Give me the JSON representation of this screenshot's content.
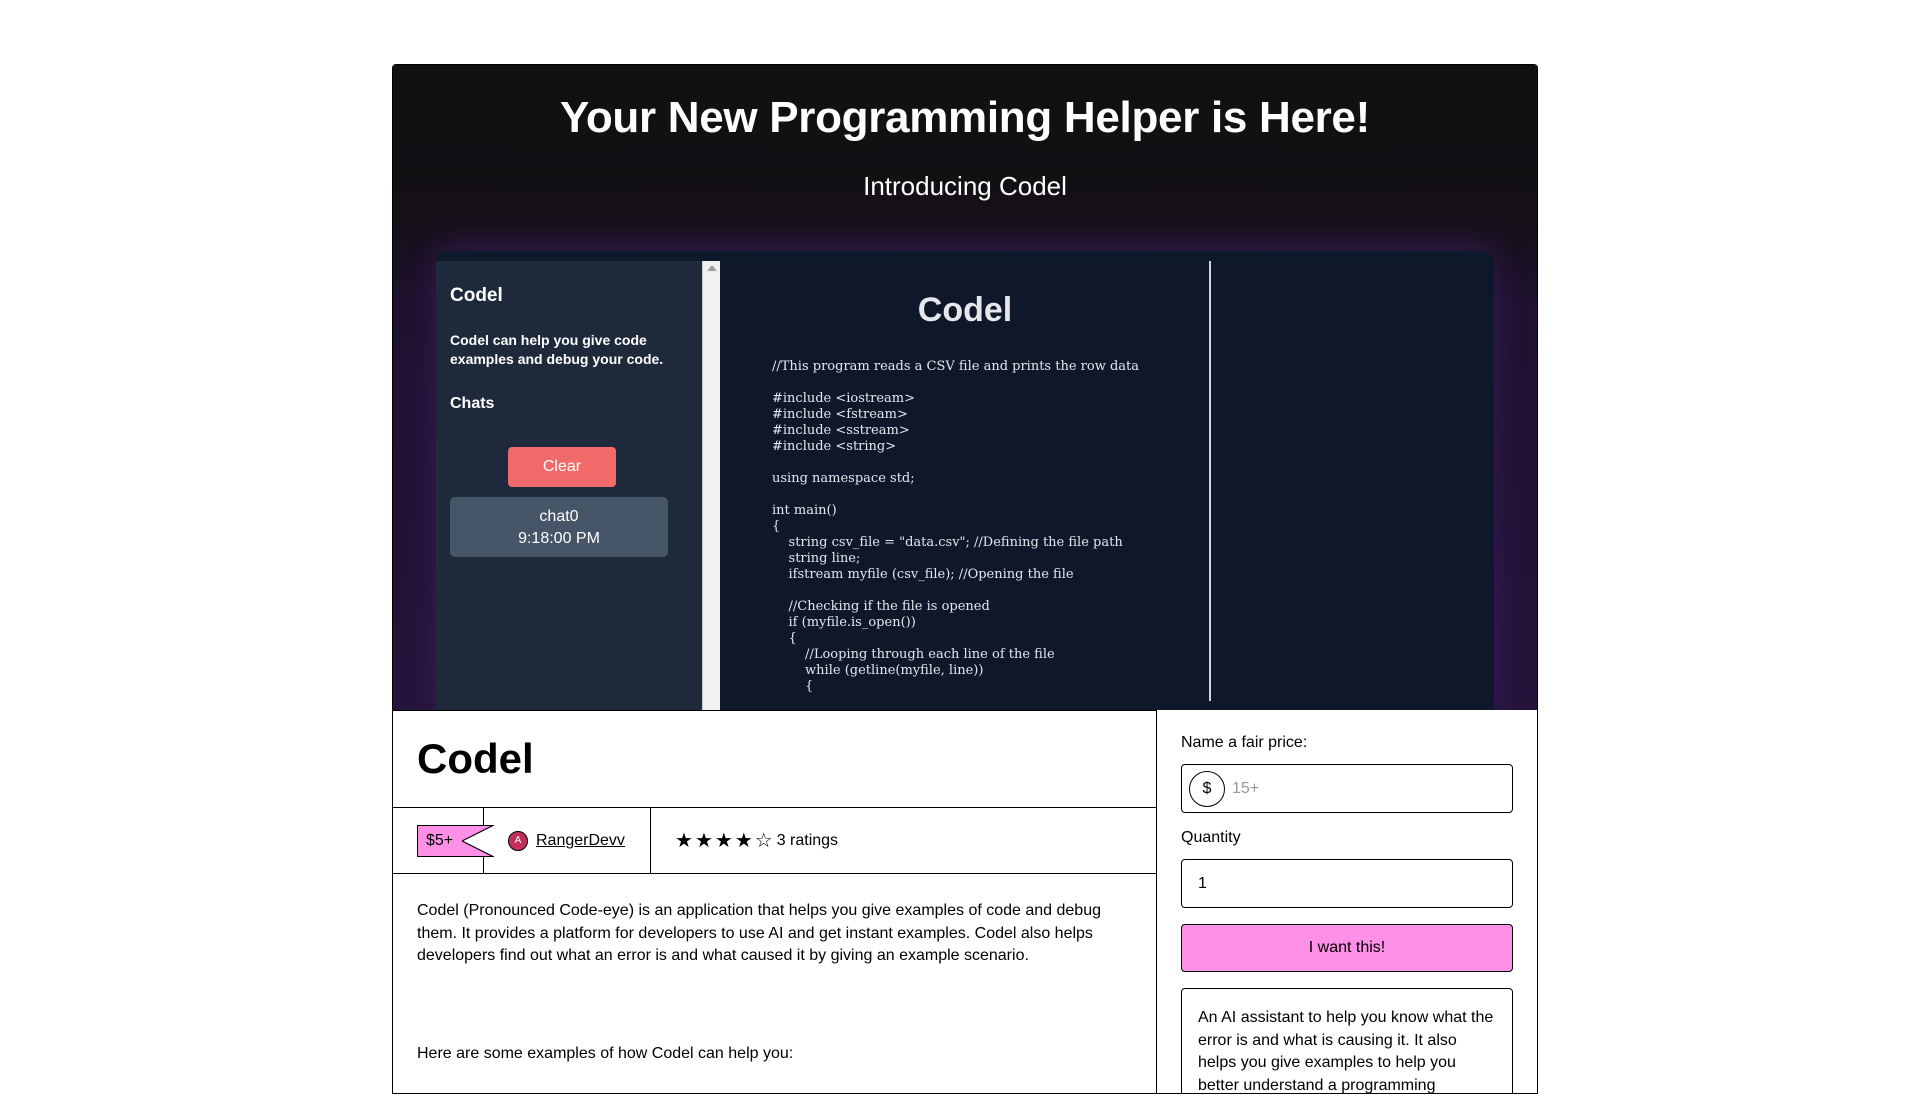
{
  "hero": {
    "title": "Your New Programming Helper is Here!",
    "subtitle": "Introducing Codel"
  },
  "app_preview": {
    "sidebar_title": "Codel",
    "sidebar_desc": "Codel can help you give code examples and debug your code.",
    "chats_heading": "Chats",
    "clear_label": "Clear",
    "chat_name": "chat0",
    "chat_time": "9:18:00 PM",
    "main_title": "Codel",
    "code": "//This program reads a CSV file and prints the row data\n\n#include <iostream>\n#include <fstream>\n#include <sstream>\n#include <string>\n\nusing namespace std;\n\nint main()\n{\n    string csv_file = \"data.csv\"; //Defining the file path\n    string line;\n    ifstream myfile (csv_file); //Opening the file\n\n    //Checking if the file is opened\n    if (myfile.is_open())\n    {\n        //Looping through each line of the file\n        while (getline(myfile, line))\n        {"
  },
  "product": {
    "title": "Codel",
    "price_badge": "$5+",
    "author_initial": "A",
    "author": "RangerDevv",
    "rating_count_text": "3 ratings",
    "rating": 4,
    "rating_max": 5,
    "description": "Codel (Pronounced Code-eye) is an application that helps you give examples of code and debug them. It provides a platform for developers to use AI and get instant examples. Codel also helps developers find out what an error is and what caused it by giving an example scenario.",
    "examples_intro": "Here are some examples of how Codel can help you:"
  },
  "purchase": {
    "price_label": "Name a fair price:",
    "currency_symbol": "$",
    "price_placeholder": "15+",
    "quantity_label": "Quantity",
    "quantity_value": "1",
    "cta_label": "I want this!",
    "summary": "An AI assistant to help you know what the error is and what is causing it. It also helps you give examples to help you better understand a programming"
  },
  "colors": {
    "accent_pink": "#ff90e8",
    "clear_button": "#f06a6a",
    "app_sidebar": "#1e293b",
    "app_main": "#0f172a"
  }
}
